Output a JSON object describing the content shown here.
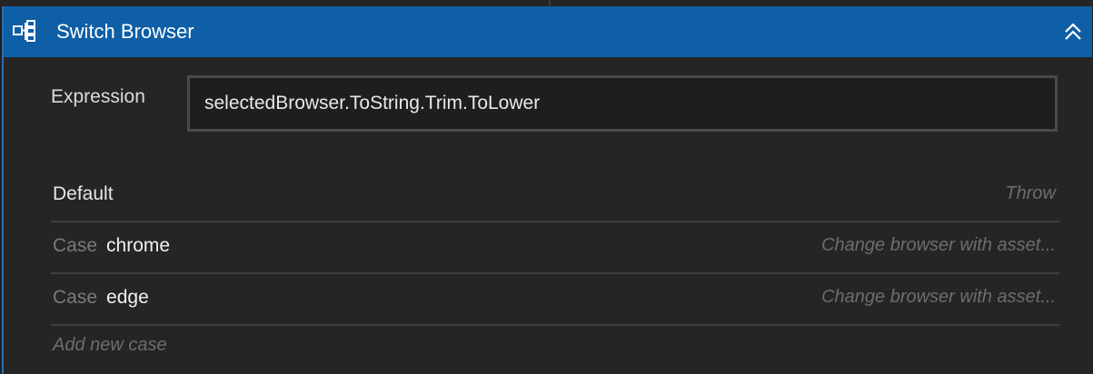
{
  "activity": {
    "title": "Switch Browser",
    "icon": "switch-icon",
    "collapse_icon": "chevron-double-up-icon"
  },
  "expression": {
    "label": "Expression",
    "value": "selectedBrowser.ToString.Trim.ToLower"
  },
  "default_row": {
    "label": "Default",
    "action": "Throw"
  },
  "cases": [
    {
      "keyword": "Case",
      "value": "chrome",
      "action": "Change browser with asset..."
    },
    {
      "keyword": "Case",
      "value": "edge",
      "action": "Change browser with asset..."
    }
  ],
  "add_case_label": "Add new case",
  "colors": {
    "title_bar": "#0e5fa6",
    "panel_bg": "#252526",
    "accent_border": "#2a6fb0"
  }
}
